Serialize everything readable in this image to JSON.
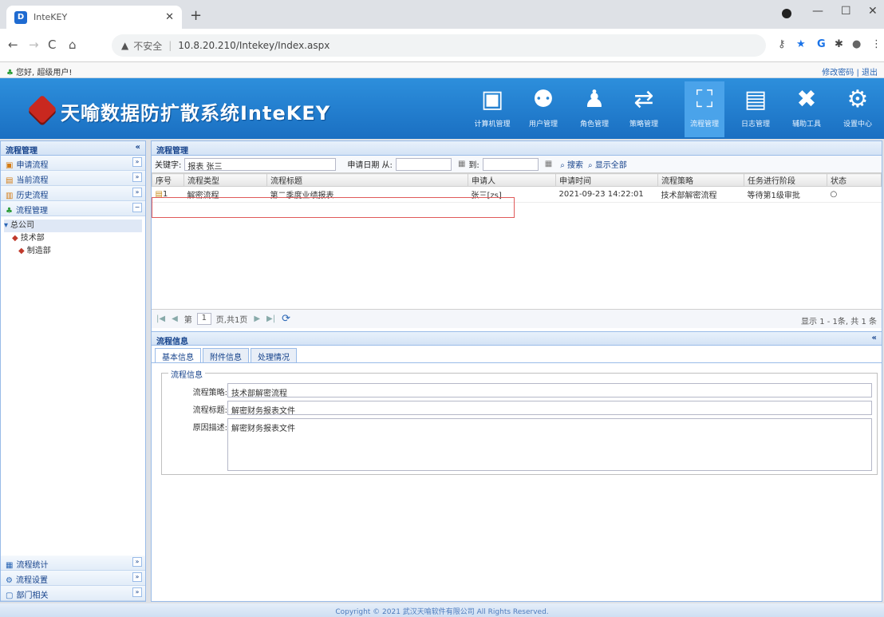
{
  "browser": {
    "tab_title": "InteKEY",
    "url": "10.8.20.210/Intekey/Index.aspx",
    "security_label": "不安全"
  },
  "topbar": {
    "greeting": "您好, 超级用户!",
    "links": "修改密码 | 退出"
  },
  "app": {
    "title": "天喻数据防扩散系统InteKEY",
    "menu": [
      {
        "label": "计算机管理",
        "icon": "monitor-icon"
      },
      {
        "label": "用户管理",
        "icon": "users-icon"
      },
      {
        "label": "角色管理",
        "icon": "roles-icon"
      },
      {
        "label": "策略管理",
        "icon": "shuffle-icon"
      },
      {
        "label": "流程管理",
        "icon": "flow-icon",
        "active": true
      },
      {
        "label": "日志管理",
        "icon": "log-icon"
      },
      {
        "label": "辅助工具",
        "icon": "tools-icon"
      },
      {
        "label": "设置中心",
        "icon": "settings-icon"
      }
    ]
  },
  "sidebar": {
    "title": "流程管理",
    "items": [
      {
        "label": "申请流程"
      },
      {
        "label": "当前流程"
      },
      {
        "label": "历史流程"
      },
      {
        "label": "流程管理"
      }
    ],
    "tree": {
      "root": "总公司",
      "children": [
        "技术部",
        "制造部"
      ]
    },
    "bottom_items": [
      {
        "label": "流程统计"
      },
      {
        "label": "流程设置"
      },
      {
        "label": "部门相关"
      }
    ]
  },
  "main": {
    "title": "流程管理",
    "search": {
      "keyword_label": "关键字:",
      "keyword_value": "报表 张三",
      "date_label": "申请日期 从:",
      "to_label": "到:",
      "search_btn": "搜索",
      "show_all_btn": "显示全部"
    },
    "columns": [
      "序号",
      "流程类型",
      "流程标题",
      "申请人",
      "申请时间",
      "流程策略",
      "任务进行阶段",
      "状态"
    ],
    "rows": [
      {
        "no": "1",
        "type": "解密流程",
        "title": "第二季度业绩报表",
        "applicant": "张三[zs]",
        "time": "2021-09-23 14:22:01",
        "policy": "技术部解密流程",
        "stage": "等待第1级审批",
        "status": "○"
      }
    ],
    "pager": {
      "page_label": "第",
      "page_value": "1",
      "total_pages": "页,共1页",
      "summary": "显示 1 - 1条, 共 1 条"
    }
  },
  "detail": {
    "title": "流程信息",
    "tabs": [
      "基本信息",
      "附件信息",
      "处理情况"
    ],
    "legend": "流程信息",
    "fields": [
      {
        "label": "流程策略:",
        "value": "技术部解密流程"
      },
      {
        "label": "流程标题:",
        "value": "解密财务报表文件"
      },
      {
        "label": "原因描述:",
        "value": "解密财务报表文件"
      }
    ]
  },
  "footer": {
    "copyright": "Copyright © 2021 武汉天喻软件有限公司 All Rights Reserved."
  }
}
